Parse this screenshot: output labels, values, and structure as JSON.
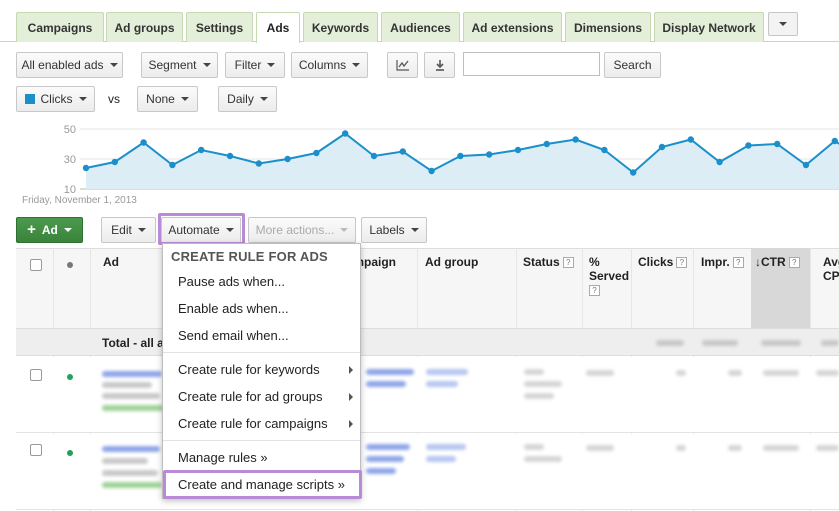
{
  "tabs": [
    "Campaigns",
    "Ad groups",
    "Settings",
    "Ads",
    "Keywords",
    "Audiences",
    "Ad extensions",
    "Dimensions",
    "Display Network"
  ],
  "active_tab": "Ads",
  "toolbar": {
    "filter_ads": "All enabled ads",
    "segment": "Segment",
    "filter": "Filter",
    "columns": "Columns",
    "search_button": "Search",
    "search_value": ""
  },
  "graph_controls": {
    "metric1": "Clicks",
    "vs": "vs",
    "metric2": "None",
    "period": "Daily",
    "metric1_color": "#1a8fc9"
  },
  "chart_data": {
    "type": "area",
    "yticks": [
      "50",
      "30",
      "10"
    ],
    "ylim": [
      10,
      50
    ],
    "date_label": "Friday, November 1, 2013",
    "values": [
      24,
      28,
      41,
      26,
      36,
      32,
      27,
      30,
      34,
      47,
      32,
      35,
      22,
      32,
      33,
      36,
      40,
      43,
      36,
      21,
      38,
      43,
      28,
      39,
      40,
      26,
      42,
      30,
      38
    ],
    "color": "#1a8fc9",
    "fill": "#ddedf6"
  },
  "actions": {
    "add_ad": "Ad",
    "edit": "Edit",
    "automate": "Automate",
    "more_actions": "More actions...",
    "labels": "Labels"
  },
  "table": {
    "headers": {
      "ad": "Ad",
      "campaign": "Campaign",
      "ad_group": "Ad group",
      "status": "Status",
      "served": "% Served",
      "clicks": "Clicks",
      "impr": "Impr.",
      "ctr": "CTR",
      "avg": "Avg. CPC"
    },
    "total_label": "Total - all ads",
    "help_mark": "?",
    "sort_indicator": "↓"
  },
  "automate_menu": {
    "heading": "CREATE RULE FOR ADS",
    "items": [
      "Pause ads when...",
      "Enable ads when...",
      "Send email when...",
      "Create rule for keywords",
      "Create rule for ad groups",
      "Create rule for campaigns",
      "Manage rules »",
      "Create and manage scripts »"
    ]
  },
  "colors": {
    "tab_bg": "#e4efd9",
    "highlight": "#b98bd6",
    "green_button": "#3f8a41",
    "status_enabled": "#1fa35b"
  }
}
